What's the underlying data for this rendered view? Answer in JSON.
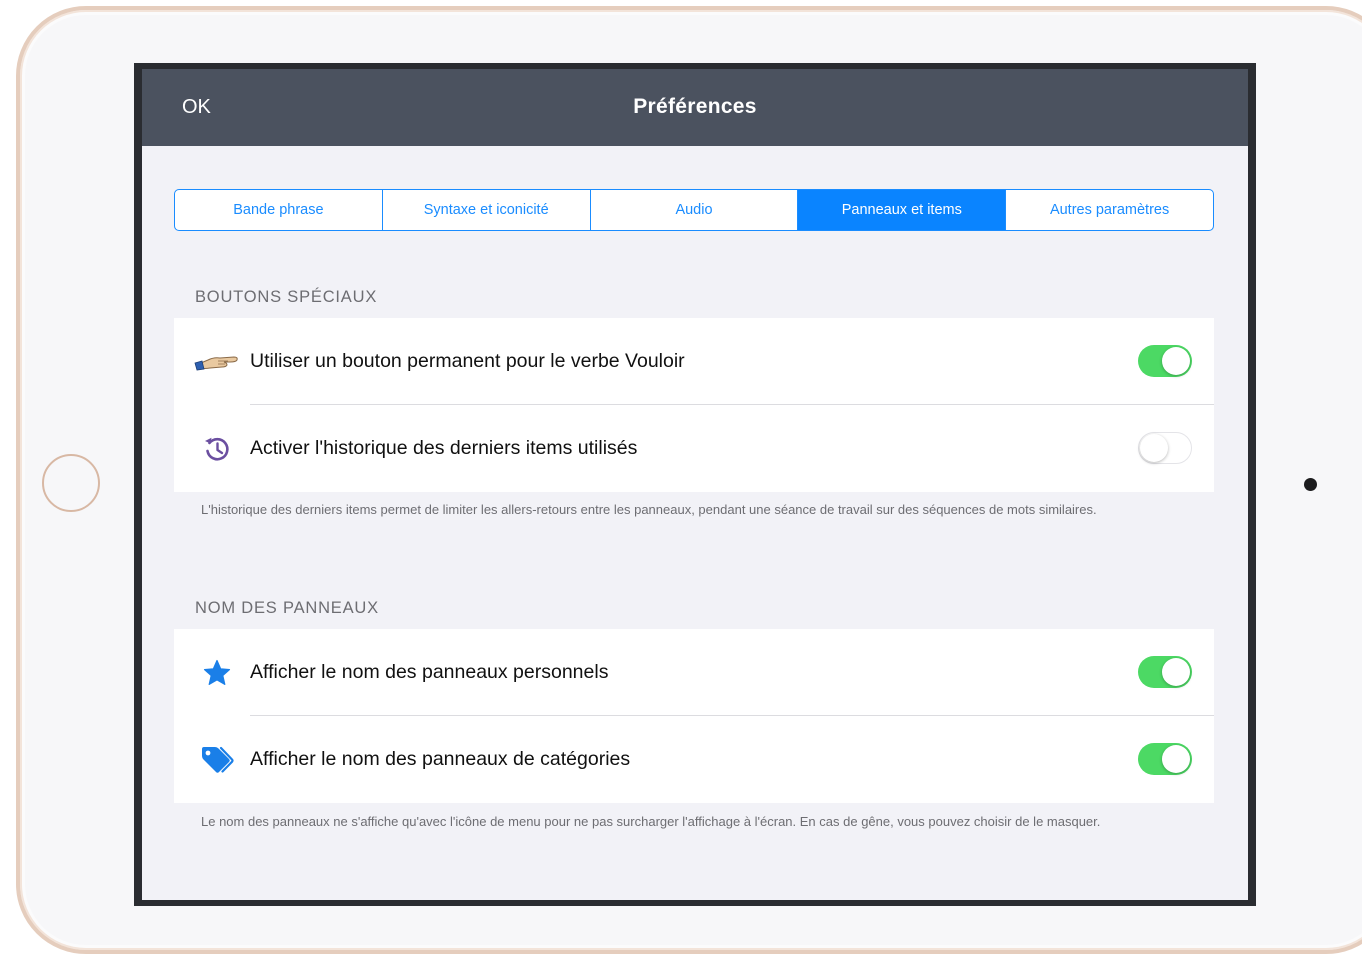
{
  "nav": {
    "ok_label": "OK",
    "title": "Préférences"
  },
  "tabs": [
    {
      "label": "Bande phrase",
      "active": false
    },
    {
      "label": "Syntaxe et iconicité",
      "active": false
    },
    {
      "label": "Audio",
      "active": false
    },
    {
      "label": "Panneaux et items",
      "active": true
    },
    {
      "label": "Autres paramètres",
      "active": false
    }
  ],
  "sections": [
    {
      "header": "BOUTONS SPÉCIAUX",
      "rows": [
        {
          "icon": "pointing-hand-icon",
          "label": "Utiliser un bouton permanent pour le verbe Vouloir",
          "toggle": true
        },
        {
          "icon": "history-icon",
          "label": "Activer l'historique des derniers items utilisés",
          "toggle": false
        }
      ],
      "footer": "L'historique des derniers items permet de limiter les allers-retours entre les panneaux, pendant une séance de travail sur des séquences de mots similaires."
    },
    {
      "header": "NOM DES PANNEAUX",
      "rows": [
        {
          "icon": "star-icon",
          "label": "Afficher le nom des panneaux personnels",
          "toggle": true
        },
        {
          "icon": "tag-icon",
          "label": "Afficher le nom des panneaux de catégories",
          "toggle": true
        }
      ],
      "footer": "Le nom des panneaux ne s'affiche qu'avec l'icône de menu pour ne pas surcharger l'affichage à l'écran. En cas de gêne, vous pouvez choisir de le masquer."
    }
  ],
  "colors": {
    "accent": "#0a84ff",
    "toggle_on": "#4cd964",
    "navbar": "#4b525f",
    "history_icon": "#6b4fa0",
    "star_icon": "#1a7fe8"
  }
}
